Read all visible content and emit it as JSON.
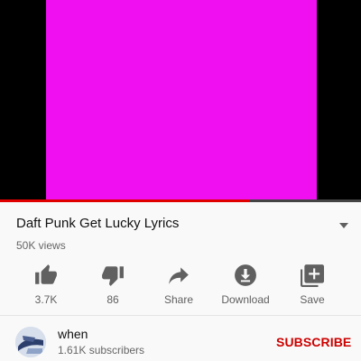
{
  "player": {
    "video_color": "#f00ff0",
    "progress_fraction": 0.69,
    "progress_color": "#e00000"
  },
  "video": {
    "title": "Daft Punk Get Lucky Lyrics",
    "views": "50K views"
  },
  "actions": [
    {
      "icon": "thumbs-up-icon",
      "label": "3.7K"
    },
    {
      "icon": "thumbs-down-icon",
      "label": "86"
    },
    {
      "icon": "share-icon",
      "label": "Share"
    },
    {
      "icon": "download-icon",
      "label": "Download"
    },
    {
      "icon": "add-to-playlist-icon",
      "label": "Save"
    }
  ],
  "channel": {
    "name": "when",
    "subscribers": "1.61K subscribers",
    "subscribe_label": "SUBSCRIBE",
    "subscribe_color": "#cc0000"
  }
}
